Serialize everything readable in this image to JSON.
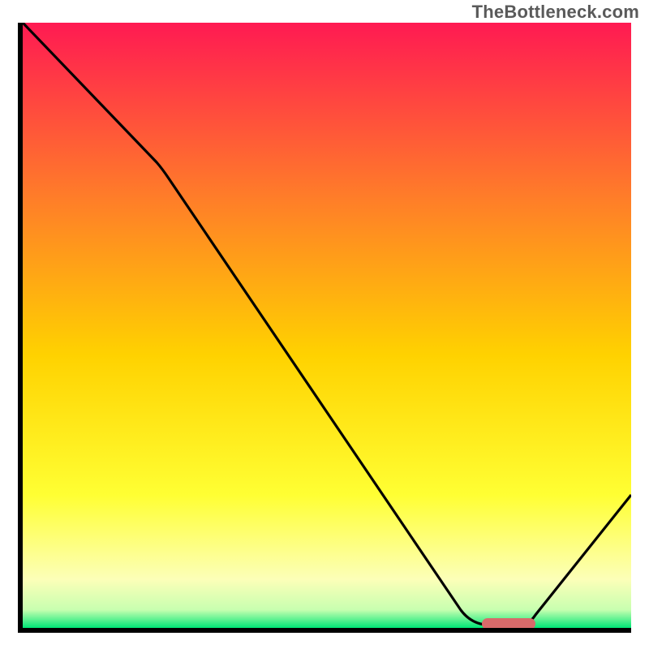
{
  "watermark": "TheBottleneck.com",
  "chart_data": {
    "type": "line",
    "title": "",
    "xlabel": "",
    "ylabel": "",
    "xlim": [
      0,
      100
    ],
    "ylim": [
      0,
      100
    ],
    "grid": false,
    "legend": false,
    "background_gradient": {
      "top": "#ff1a52",
      "mid1": "#ff7a2a",
      "mid2": "#ffd200",
      "mid3": "#ffff33",
      "mid4": "#fcffb8",
      "bottom": "#00e676"
    },
    "series": [
      {
        "name": "bottleneck-curve",
        "x": [
          0,
          22,
          72,
          78,
          82,
          100
        ],
        "y": [
          100,
          77,
          3,
          0,
          0,
          22
        ]
      }
    ],
    "marker": {
      "name": "optimal-zone-marker",
      "x_center": 80,
      "x_halfwidth": 4,
      "y": 0,
      "color": "#d86a6a"
    }
  }
}
